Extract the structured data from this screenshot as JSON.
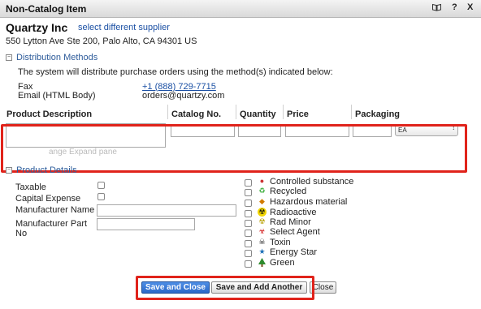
{
  "window": {
    "title": "Non-Catalog Item",
    "icon_book": "book-icon",
    "help_label": "?",
    "close_label": "X"
  },
  "supplier": {
    "name": "Quartzy Inc",
    "change_link": "select different supplier",
    "address": "550 Lytton Ave Ste 200, Palo Alto, CA 94301 US"
  },
  "distribution": {
    "heading": "Distribution Methods",
    "intro": "The system will distribute purchase orders using the method(s) indicated below:",
    "methods": [
      {
        "label": "Fax",
        "value": "+1 (888) 729-7715"
      },
      {
        "label": "Email (HTML Body)",
        "value": "orders@quartzy.com"
      }
    ]
  },
  "item_form": {
    "columns": [
      "Product Description",
      "Catalog No.",
      "Quantity",
      "Price",
      "Packaging"
    ],
    "values": {
      "description": "",
      "catalog_no": "",
      "quantity": "",
      "price": "",
      "packaging_qty": ""
    },
    "unit_selected": "EA",
    "obscured_text": "ange Expand pane"
  },
  "product_details": {
    "heading": "Product Details",
    "fields": {
      "taxable": "Taxable",
      "capital_expense": "Capital Expense",
      "manufacturer_name": "Manufacturer Name",
      "manufacturer_part_line1": "Manufacturer Part",
      "manufacturer_part_line2": "No"
    },
    "attributes": [
      {
        "label": "Controlled substance",
        "icon": "controlled-substance-icon"
      },
      {
        "label": "Recycled",
        "icon": "recycled-icon"
      },
      {
        "label": "Hazardous material",
        "icon": "hazardous-material-icon"
      },
      {
        "label": "Radioactive",
        "icon": "radioactive-icon"
      },
      {
        "label": "Rad Minor",
        "icon": "rad-minor-icon"
      },
      {
        "label": "Select Agent",
        "icon": "select-agent-icon"
      },
      {
        "label": "Toxin",
        "icon": "toxin-icon"
      },
      {
        "label": "Energy Star",
        "icon": "energy-star-icon"
      },
      {
        "label": "Green",
        "icon": "green-tree-icon"
      }
    ]
  },
  "actions": {
    "save_close": "Save and Close",
    "save_add": "Save and Add Another",
    "close": "Close"
  },
  "colors": {
    "highlight": "#e0231b",
    "link": "#1a4fa3",
    "primary_button": "#2a67c7"
  }
}
